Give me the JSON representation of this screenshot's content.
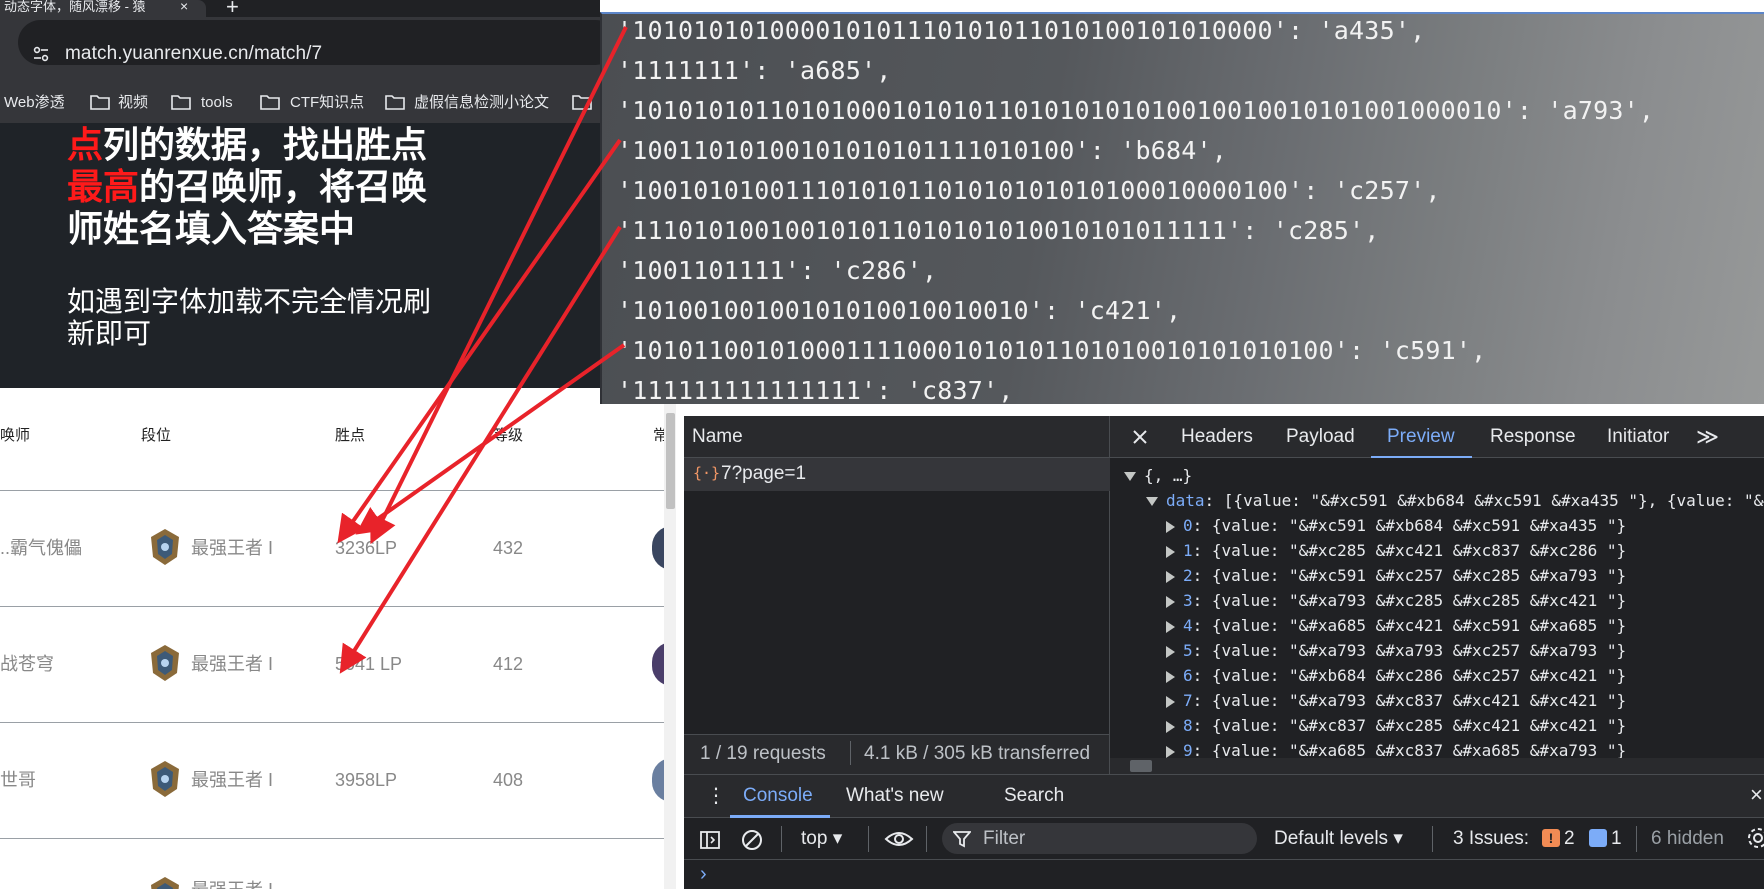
{
  "browser": {
    "tab_title": "动态字体，随风漂移 - 猿",
    "tab_close": "×",
    "new_tab": "+",
    "url": "match.yuanrenxue.cn/match/7",
    "bookmarks": [
      {
        "label": "Web渗透",
        "icon": ""
      },
      {
        "label": "视频",
        "icon": "folder-icon"
      },
      {
        "label": "tools",
        "icon": "folder-icon"
      },
      {
        "label": "CTF知识点",
        "icon": "folder-icon"
      },
      {
        "label": "虚假信息检测小论文",
        "icon": "folder-icon"
      }
    ]
  },
  "hero": {
    "line1_red": "点",
    "line1_rest": "列的数据，找出胜点",
    "line2_red": "最高",
    "line2_rest": "的召唤师，将召唤",
    "line3": "师姓名填入答案中",
    "note_line1": "如遇到字体加载不完全情况刷",
    "note_line2": "新即可"
  },
  "table": {
    "headers": [
      "唤师",
      "段位",
      "胜点",
      "等级",
      "常"
    ],
    "rows": [
      {
        "name": "..霸气傀儡",
        "rank": "最强王者 I",
        "points": "3236LP",
        "level": "432"
      },
      {
        "name": "战苍穹",
        "rank": "最强王者 I",
        "points": "5041 LP",
        "level": "412"
      },
      {
        "name": "世哥",
        "rank": "最强王者 I",
        "points": "3958LP",
        "level": "408"
      },
      {
        "name": "...",
        "rank": "最强王者 I",
        "points": "",
        "level": ""
      }
    ]
  },
  "code_overlay": {
    "lines": [
      "'101010101000010101110101011010100101010000': 'a435',",
      "'1111111': 'a685',",
      "'101010101101010001010101101010101010010010010101001000010': 'a793',",
      "'10011010100101010101111010100': 'b684',",
      "'1001010100111010101101010101010100010000100': 'c257',",
      "'111010100100101011010101010010101011111': 'c285',",
      "'1001101111': 'c286',",
      "'10100100100101010010010010': 'c421',",
      "'1010110010100011110001010101101010010101010100': 'c591',",
      "'111111111111111': 'c837',"
    ]
  },
  "devtools": {
    "name_header": "Name",
    "tabs": [
      "Headers",
      "Payload",
      "Preview",
      "Response",
      "Initiator"
    ],
    "active_tab": "Preview",
    "more": "≫",
    "request_icon": "{·}",
    "request_name": "7?page=1",
    "summary_requests": "1 / 19 requests",
    "summary_transfer": "4.1 kB / 305 kB transferred",
    "preview_root": "{, …}",
    "preview_data_key": "data",
    "preview_data_summary": "[{value: \"&#xc591 &#xb684 &#xc591 &#xa435 \"}, {value: \"&#x",
    "preview_items": [
      {
        "index": "0",
        "value": "&#xc591 &#xb684 &#xc591 &#xa435 "
      },
      {
        "index": "1",
        "value": "&#xc285 &#xc421 &#xc837 &#xc286 "
      },
      {
        "index": "2",
        "value": "&#xc591 &#xc257 &#xc285 &#xa793 "
      },
      {
        "index": "3",
        "value": "&#xa793 &#xc285 &#xc285 &#xc421 "
      },
      {
        "index": "4",
        "value": "&#xa685 &#xc421 &#xc591 &#xa685 "
      },
      {
        "index": "5",
        "value": "&#xa793 &#xa793 &#xc257 &#xa793 "
      },
      {
        "index": "6",
        "value": "&#xb684 &#xc286 &#xc257 &#xc421 "
      },
      {
        "index": "7",
        "value": "&#xa793 &#xc837 &#xc421 &#xc421 "
      },
      {
        "index": "8",
        "value": "&#xc837 &#xc285 &#xc421 &#xc421 "
      },
      {
        "index": "9",
        "value": "&#xa685 &#xc837 &#xa685 &#xa793 "
      }
    ],
    "drawer_tabs": [
      "Console",
      "What's new",
      "Search"
    ],
    "drawer_active": "Console",
    "console": {
      "context": "top ▾",
      "filter_placeholder": "Filter",
      "levels": "Default levels ▾",
      "issues_label": "3 Issues:",
      "issues_warn": "2",
      "issues_info": "1",
      "hidden": "6 hidden",
      "prompt": "›"
    }
  },
  "colors": {
    "hero_bg": "#1f2328",
    "accent_red": "#ff1a1a",
    "devtools_bg": "#202124",
    "devtools_accent": "#7cacf8",
    "arrow_red": "#e8232a"
  }
}
